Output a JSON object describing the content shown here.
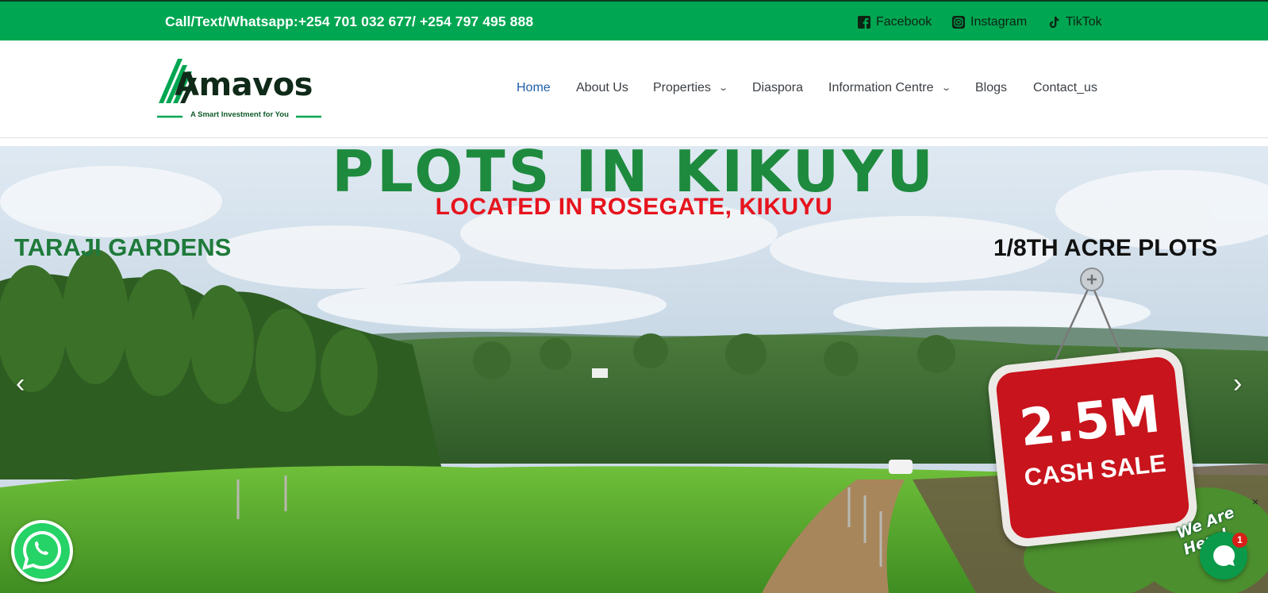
{
  "topbar": {
    "contact": "Call/Text/Whatsapp:+254 701 032 677/ +254 797 495 888",
    "social": [
      {
        "label": "Facebook",
        "icon": "facebook-icon"
      },
      {
        "label": "Instagram",
        "icon": "instagram-icon"
      },
      {
        "label": "TikTok",
        "icon": "tiktok-icon"
      }
    ]
  },
  "brand": {
    "name": "Amavos",
    "tagline": "A Smart Investment for You"
  },
  "nav": [
    {
      "label": "Home",
      "active": true
    },
    {
      "label": "About Us"
    },
    {
      "label": "Properties",
      "dropdown": true
    },
    {
      "label": "Diaspora"
    },
    {
      "label": "Information Centre",
      "dropdown": true
    },
    {
      "label": "Blogs"
    },
    {
      "label": "Contact_us"
    }
  ],
  "hero": {
    "title": "PLOTS IN KIKUYU",
    "subtitle": "LOCATED IN ROSEGATE, KIKUYU",
    "project": "TARAJI GARDENS",
    "plot_size": "1/8TH ACRE PLOTS",
    "price": "2.5M",
    "price_label": "CASH SALE",
    "prev_icon": "chevron-left-icon",
    "next_icon": "chevron-right-icon"
  },
  "chat": {
    "bubble_text": "We Are Here!",
    "unread": "1",
    "close": "×"
  },
  "colors": {
    "topbar_green": "#00a651",
    "title_green": "#1e8a3e",
    "subtitle_red": "#e6141e",
    "nav_active": "#1e5fa8",
    "sign_red": "#c8141c"
  }
}
